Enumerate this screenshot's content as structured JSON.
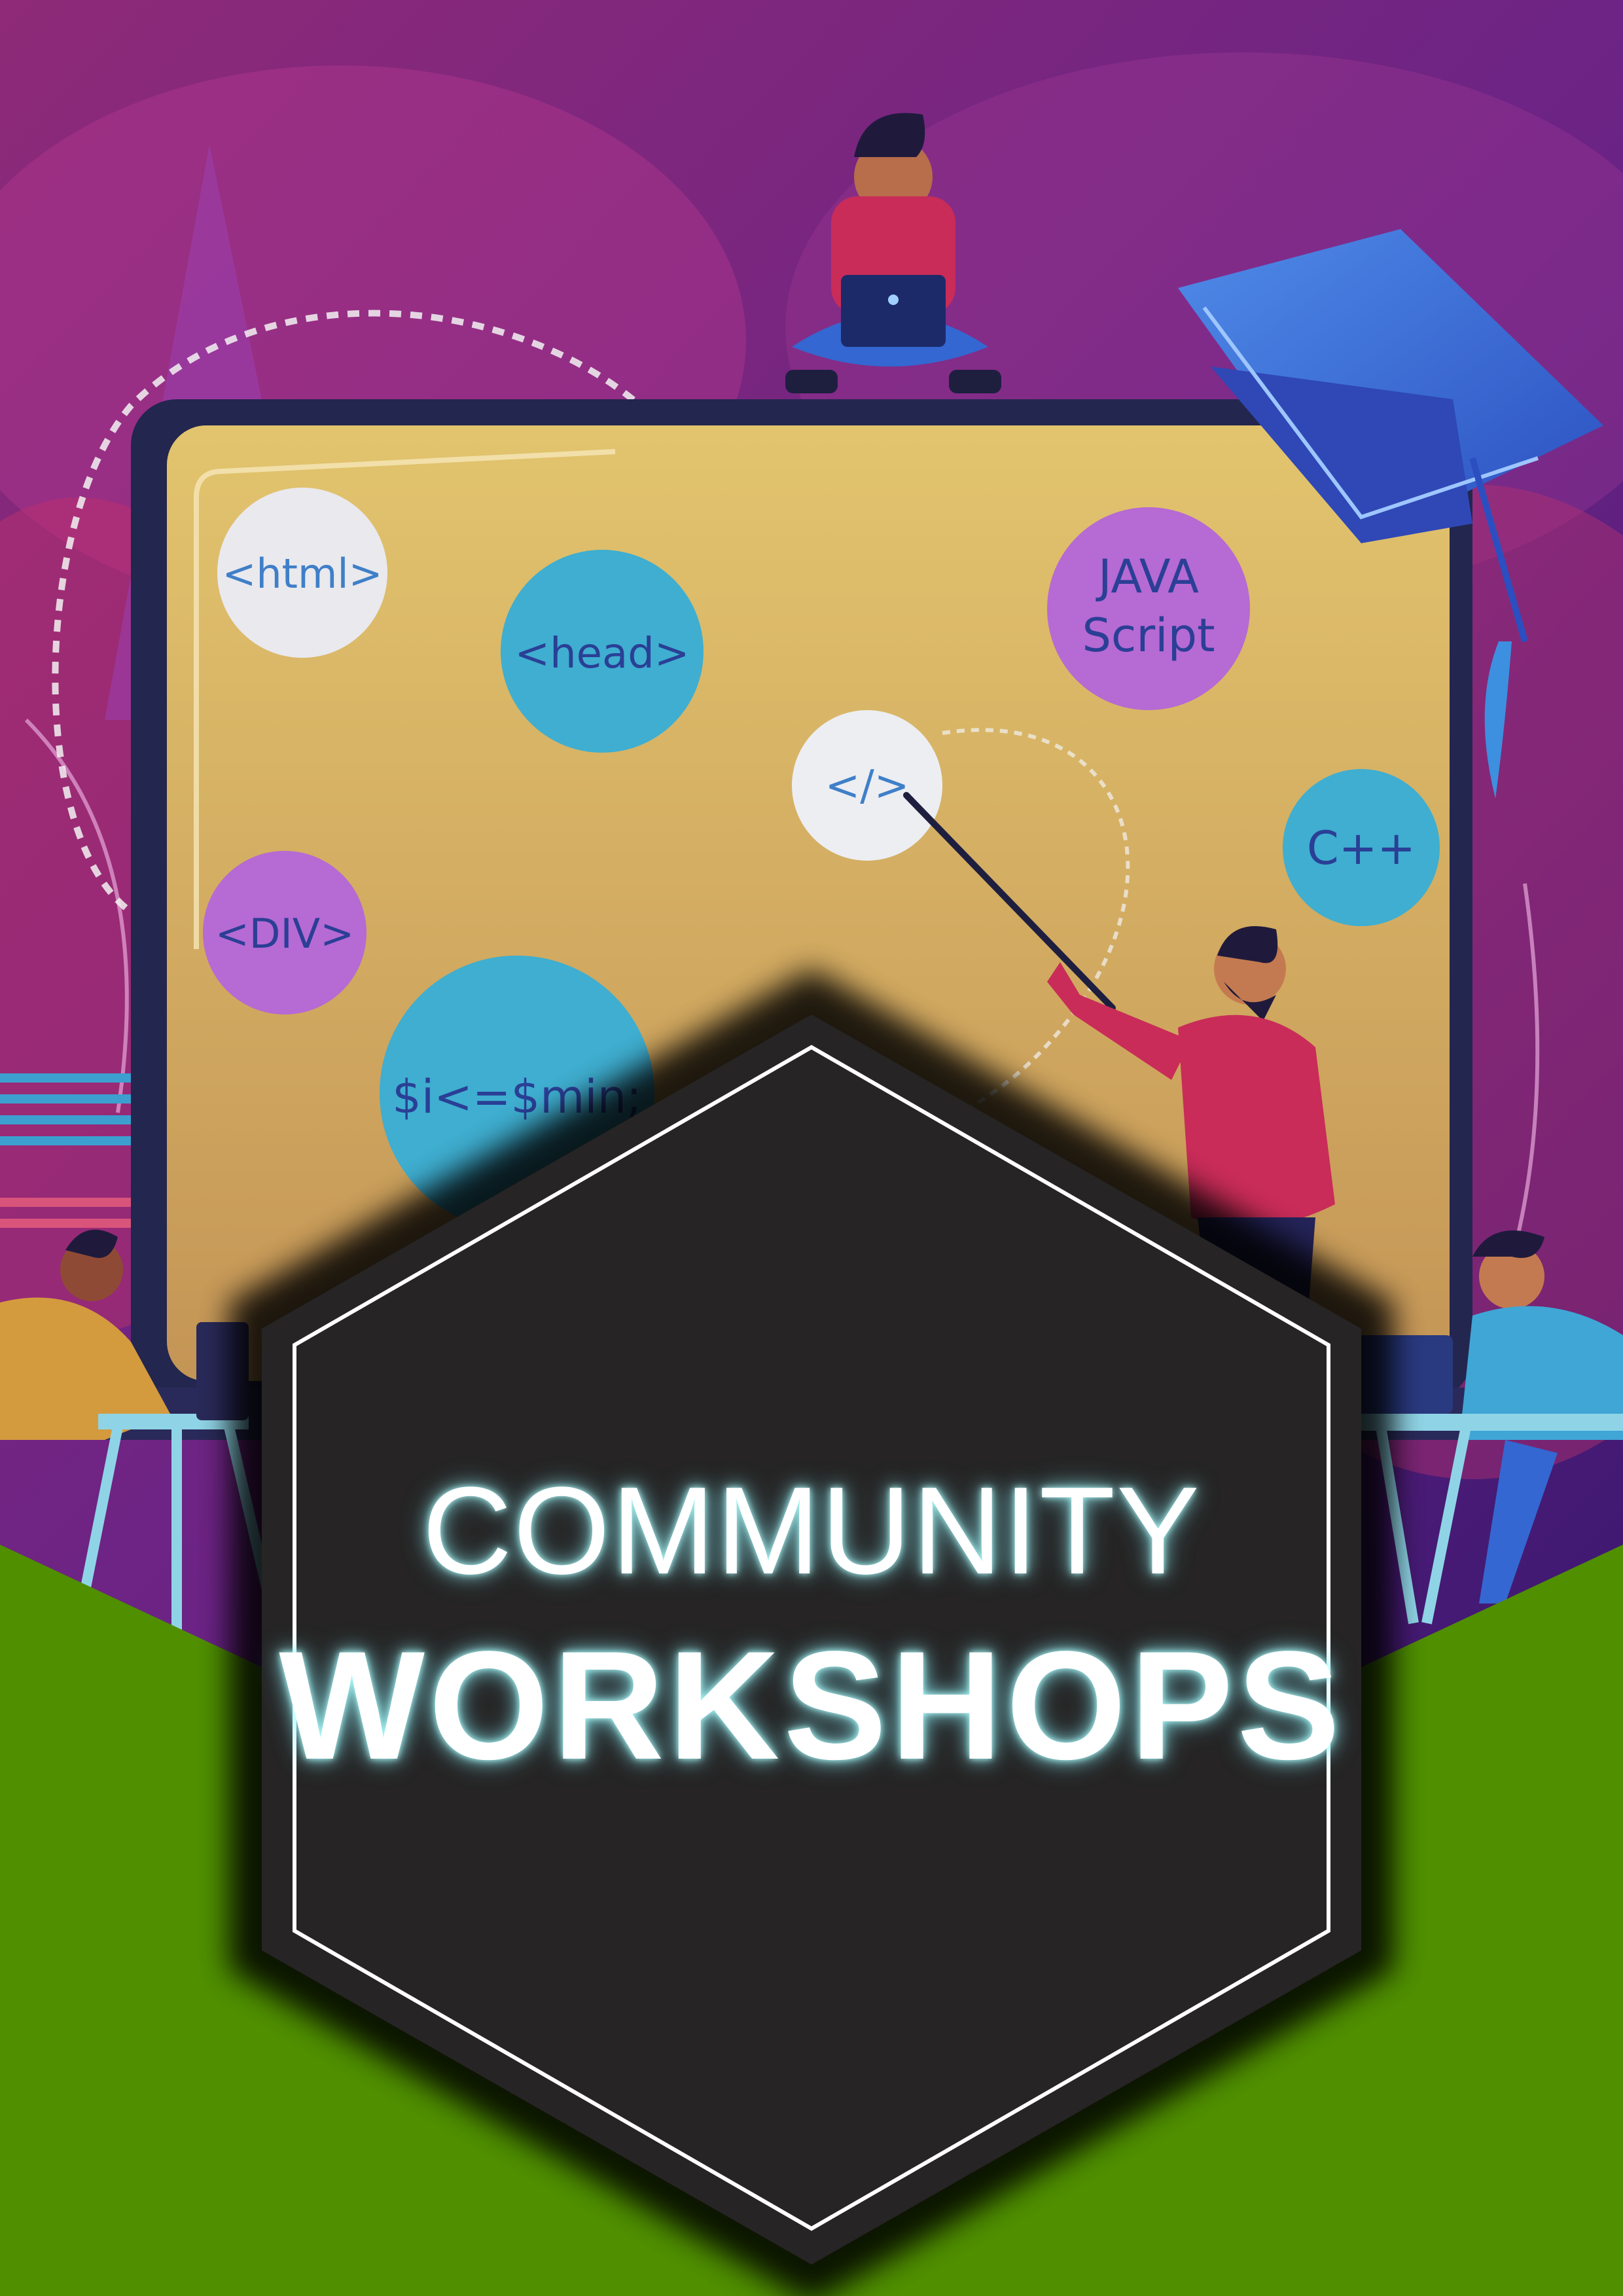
{
  "poster": {
    "title_line1": "COMMUNITY",
    "title_line2": "WORKSHOPS"
  },
  "illustration": {
    "code_bubbles": [
      {
        "id": "html",
        "text": "<html>"
      },
      {
        "id": "head",
        "text": "<head>"
      },
      {
        "id": "javascript",
        "lines": [
          "JAVA",
          "Script"
        ]
      },
      {
        "id": "close-tag",
        "text": "</>"
      },
      {
        "id": "cpp",
        "text": "C++"
      },
      {
        "id": "div",
        "text": "<DIV>"
      },
      {
        "id": "php",
        "text": "$i<=$min;"
      }
    ]
  },
  "colors": {
    "background_top": "#7a2680",
    "background_bottom": "#4b1a7a",
    "screen": "#d8b266",
    "green_band": "#4f8f00",
    "hexagon": "#262424",
    "accent_blue": "#2e6fd6"
  }
}
